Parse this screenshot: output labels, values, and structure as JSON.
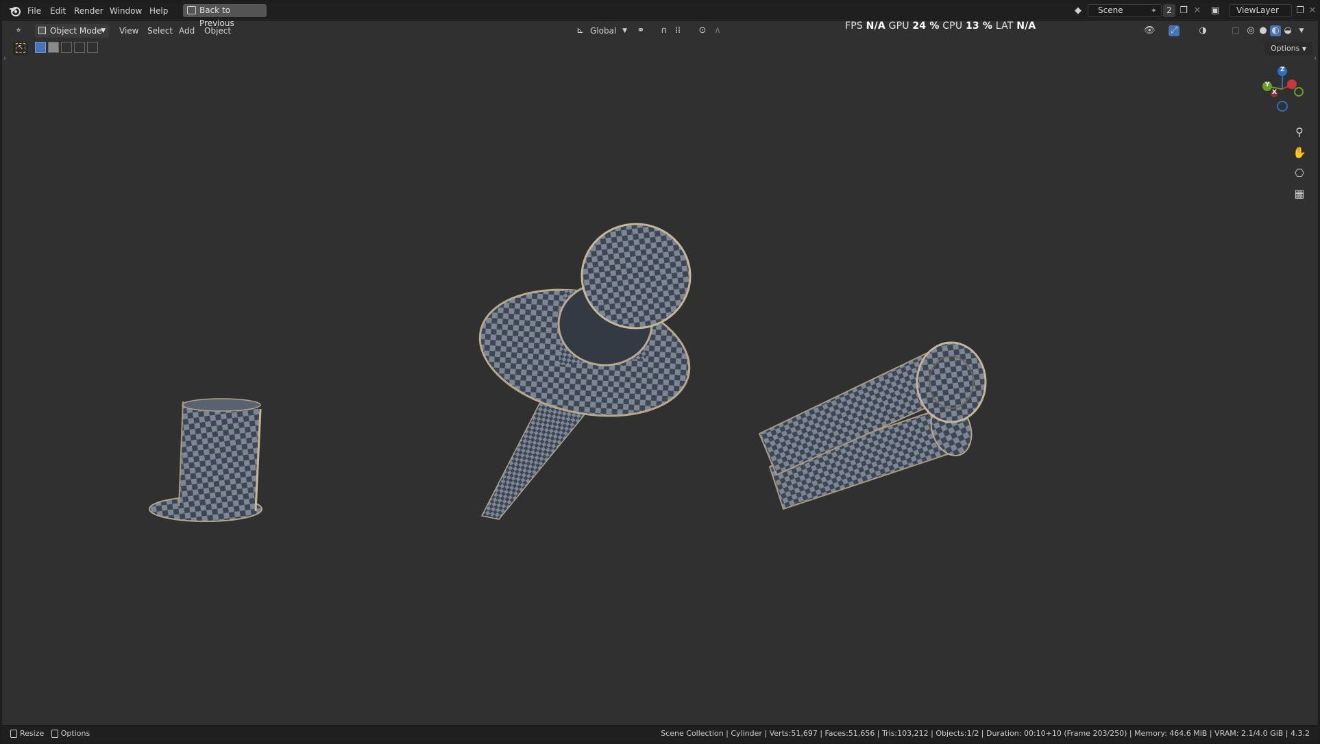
{
  "menu": {
    "file": "File",
    "edit": "Edit",
    "render": "Render",
    "window": "Window",
    "help": "Help",
    "back_to_previous": "Back to Previous"
  },
  "scene": {
    "name": "Scene",
    "count": "2",
    "view_layer": "ViewLayer"
  },
  "header": {
    "mode": "Object Mode",
    "view": "View",
    "select": "Select",
    "add": "Add",
    "object": "Object",
    "orientation": "Global",
    "options": "Options"
  },
  "stats": {
    "fps_label": "FPS",
    "fps_value": "N/A",
    "gpu_label": "GPU",
    "gpu_value": "24 %",
    "cpu_label": "CPU",
    "cpu_value": "13 %",
    "lat_label": "LAT",
    "lat_value": "N/A"
  },
  "gizmo": {
    "z": "Z",
    "y": "Y",
    "x": "X",
    "colors": {
      "x": "#c8363f",
      "y": "#6a9e26",
      "z": "#2d6fc0"
    }
  },
  "statusbar": {
    "resize": "Resize",
    "options": "Options",
    "info": "Scene Collection | Cylinder | Verts:51,697 | Faces:51,656 | Tris:103,212 | Objects:1/2 | Duration: 00:10+10 (Frame 203/250) | Memory: 464.6 MiB | VRAM: 2.1/4.0 GiB | 4.3.2"
  },
  "colors": {
    "viewport_bg": "#303030",
    "checker_dark": "#3d4654",
    "checker_light": "#7e8694",
    "accent": "#4772b3"
  },
  "icons": [
    "blender-logo-icon",
    "back-icon",
    "scene-icon",
    "pin-icon",
    "new-scene-icon",
    "close-icon",
    "view-layer-icon",
    "editor-type-icon",
    "object-mode-icon",
    "transform-orientation-icon",
    "pivot-icon",
    "snap-icon",
    "proportional-edit-icon",
    "visibility-icon",
    "gizmo-icon",
    "overlay-icon",
    "xray-icon",
    "wireframe-shading-icon",
    "solid-shading-icon",
    "material-shading-icon",
    "rendered-shading-icon",
    "zoom-icon",
    "hand-pan-icon",
    "camera-icon",
    "grid-icon",
    "mouse-icon"
  ]
}
